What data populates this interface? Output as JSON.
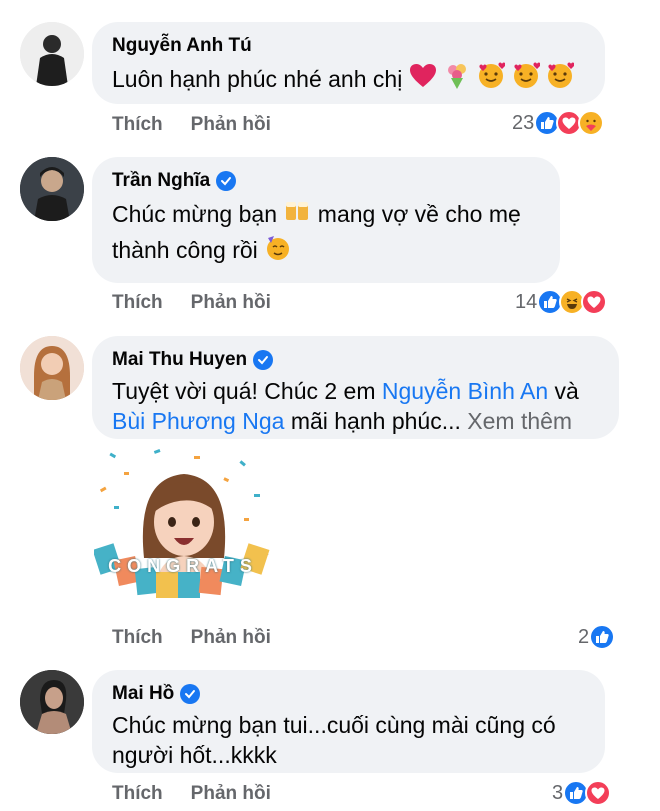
{
  "comments": [
    {
      "author": "Nguyễn Anh Tú",
      "verified": false,
      "text": "Luôn hạnh phúc nhé anh chị",
      "emojis": [
        "heart-icon",
        "bouquet-icon",
        "smiling-hearts-icon",
        "smiling-hearts-icon",
        "smiling-hearts-icon"
      ],
      "like_label": "Thích",
      "reply_label": "Phản hồi",
      "reaction_count": "23",
      "reactions": [
        "like",
        "love",
        "care"
      ]
    },
    {
      "author": "Trần Nghĩa",
      "verified": true,
      "text_part1": "Chúc mừng bạn",
      "text_part2": "mang vợ về cho mẹ",
      "text_part3": "thành công rồi",
      "like_label": "Thích",
      "reply_label": "Phản hồi",
      "reaction_count": "14",
      "reactions": [
        "like",
        "haha",
        "love"
      ]
    },
    {
      "author": "Mai Thu Huyen",
      "verified": true,
      "text_part1": "Tuyệt vời quá! Chúc 2 em",
      "mention1": "Nguyễn Bình An",
      "text_part2": "và",
      "mention2": "Bùi Phương Nga",
      "text_part3": "mãi hạnh phúc...",
      "see_more": "Xem thêm",
      "sticker_text": "CONGRATS",
      "like_label": "Thích",
      "reply_label": "Phản hồi",
      "reaction_count": "2",
      "reactions": [
        "like"
      ]
    },
    {
      "author": "Mai Hồ",
      "verified": true,
      "text_line1": "Chúc mừng bạn tui...cuối cùng mài cũng có",
      "text_line2": "người hốt...kkkk",
      "like_label": "Thích",
      "reply_label": "Phản hồi",
      "reaction_count": "3",
      "reactions": [
        "like",
        "love"
      ]
    }
  ],
  "colors": {
    "bubble": "#f0f2f5",
    "link": "#1877f2",
    "meta": "#65676b"
  }
}
